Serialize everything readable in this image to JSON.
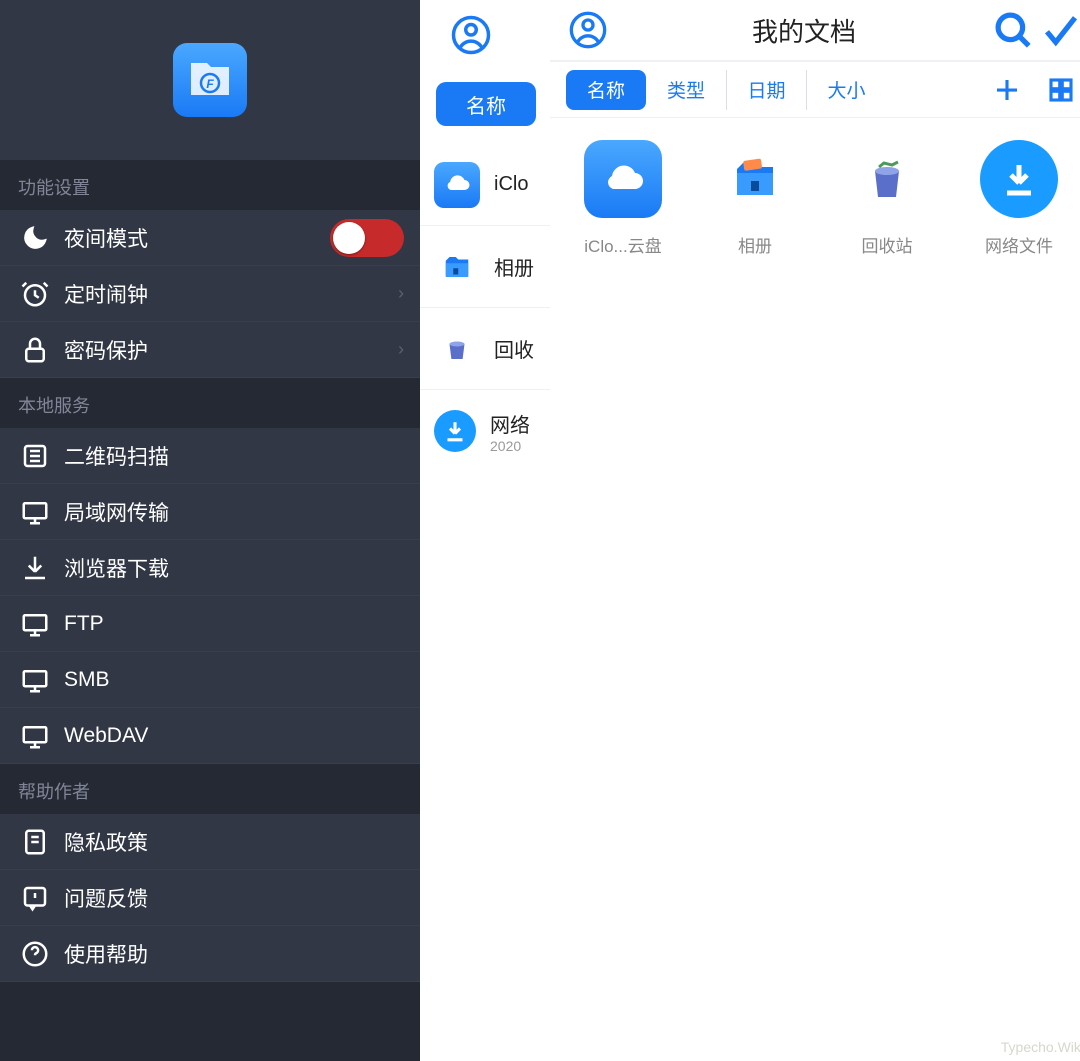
{
  "sidebar": {
    "sections": {
      "settings_title": "功能设置",
      "local_title": "本地服务",
      "help_title": "帮助作者"
    },
    "items": {
      "night_mode": "夜间模式",
      "alarm": "定时闹钟",
      "password": "密码保护",
      "qr": "二维码扫描",
      "lan": "局域网传输",
      "browser_dl": "浏览器下载",
      "ftp": "FTP",
      "smb": "SMB",
      "webdav": "WebDAV",
      "privacy": "隐私政策",
      "feedback": "问题反馈",
      "help": "使用帮助"
    }
  },
  "mid": {
    "tab_name": "名称",
    "rows": {
      "icloud": "iClo",
      "album": "相册",
      "trash": "回收",
      "net": "网络",
      "net_sub": "2020"
    }
  },
  "docs": {
    "title": "我的文档",
    "tabs": {
      "name": "名称",
      "type": "类型",
      "date": "日期",
      "size": "大小"
    },
    "grid": {
      "icloud": "iClo...云盘",
      "album": "相册",
      "trash": "回收站",
      "net": "网络文件"
    }
  },
  "watermark": "Typecho.Wiki"
}
